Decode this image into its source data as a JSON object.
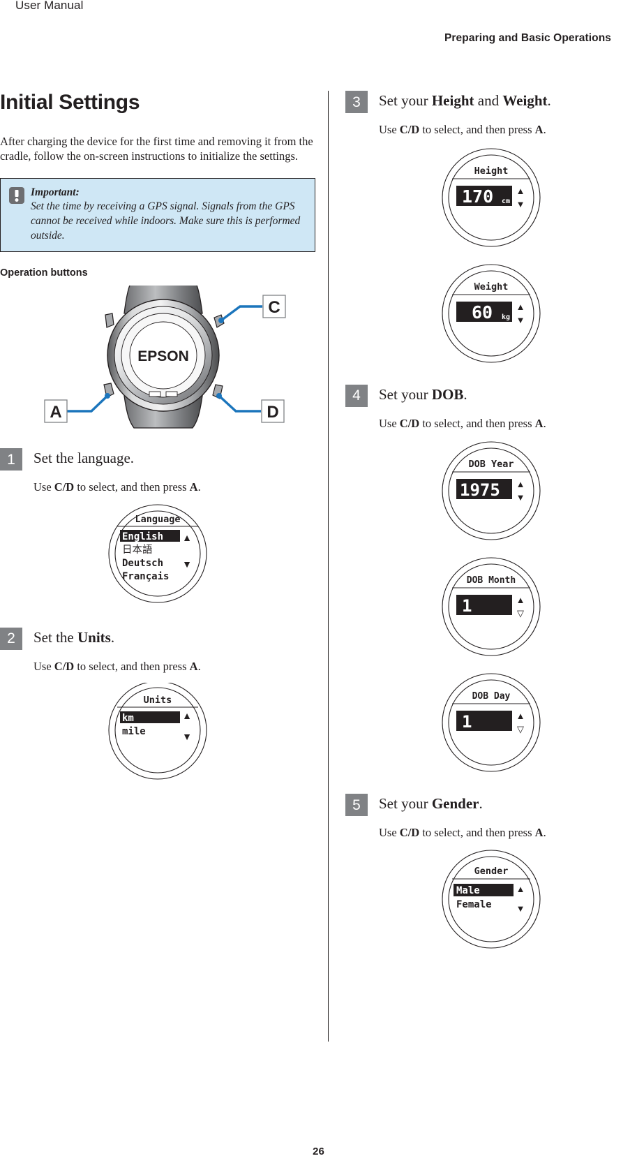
{
  "header": {
    "doc_title": "User Manual",
    "section_title": "Preparing and Basic Operations"
  },
  "footer": {
    "page_number": "26"
  },
  "left_column": {
    "title": "Initial Settings",
    "intro": "After charging the device for the first time and removing it from the cradle, follow the on-screen instructions to initialize the settings.",
    "important": {
      "label": "Important:",
      "text": "Set the time by receiving a GPS signal. Signals from the GPS cannot be received while indoors. Make sure this is performed outside.",
      "bg_color": "#cfe7f5",
      "icon_color": "#6d6e71"
    },
    "operation_buttons_heading": "Operation buttons",
    "device": {
      "brand": "EPSON",
      "callouts": [
        {
          "id": "A",
          "label": "A",
          "position": "bottom-left"
        },
        {
          "id": "C",
          "label": "C",
          "position": "top-right"
        },
        {
          "id": "D",
          "label": "D",
          "position": "bottom-right"
        }
      ],
      "callout_line_color": "#1b75bc"
    },
    "steps": [
      {
        "number": "1",
        "title_plain": "Set the language.",
        "instruction_prefix": "Use ",
        "instruction_keys": "C/D",
        "instruction_mid": " to select, and then press ",
        "instruction_key2": "A",
        "instruction_suffix": ".",
        "screen": {
          "title": "Language",
          "type": "list",
          "items": [
            "English",
            "日本語",
            "Deutsch",
            "Français"
          ],
          "selected_index": 0,
          "up_arrow": "▲",
          "down_arrow": "▼"
        }
      },
      {
        "number": "2",
        "title_prefix": "Set the ",
        "title_bold": "Units",
        "title_suffix": ".",
        "instruction_prefix": "Use ",
        "instruction_keys": "C/D",
        "instruction_mid": " to select, and then press ",
        "instruction_key2": "A",
        "instruction_suffix": ".",
        "screen": {
          "title": "Units",
          "type": "list",
          "items": [
            "km",
            "mile"
          ],
          "selected_index": 0,
          "up_arrow": "▲",
          "down_arrow": "▼"
        }
      }
    ]
  },
  "right_column": {
    "steps": [
      {
        "number": "3",
        "title_prefix": "Set your ",
        "title_bold": "Height",
        "title_mid": " and ",
        "title_bold2": "Weight",
        "title_suffix": ".",
        "instruction_prefix": "Use ",
        "instruction_keys": "C/D",
        "instruction_mid": " to select, and then press ",
        "instruction_key2": "A",
        "instruction_suffix": ".",
        "screens": [
          {
            "title": "Height",
            "type": "value",
            "value": "170",
            "unit": "cm",
            "up_arrow": "▲",
            "down_arrow": "▼"
          },
          {
            "title": "Weight",
            "type": "value",
            "value": "60",
            "unit": "kg",
            "up_arrow": "▲",
            "down_arrow": "▼"
          }
        ]
      },
      {
        "number": "4",
        "title_prefix": "Set your ",
        "title_bold": "DOB",
        "title_suffix": ".",
        "instruction_prefix": "Use ",
        "instruction_keys": "C/D",
        "instruction_mid": " to select, and then press ",
        "instruction_key2": "A",
        "instruction_suffix": ".",
        "screens": [
          {
            "title": "DOB Year",
            "type": "value",
            "value": "1975",
            "unit": "",
            "up_arrow": "▲",
            "down_arrow": "▼"
          },
          {
            "title": "DOB Month",
            "type": "value",
            "value": "1",
            "unit": "",
            "up_arrow": "▲",
            "down_arrow": "▽"
          },
          {
            "title": "DOB Day",
            "type": "value",
            "value": "1",
            "unit": "",
            "up_arrow": "▲",
            "down_arrow": "▽"
          }
        ]
      },
      {
        "number": "5",
        "title_prefix": "Set your ",
        "title_bold": "Gender",
        "title_suffix": ".",
        "instruction_prefix": "Use ",
        "instruction_keys": "C/D",
        "instruction_mid": " to select, and then press ",
        "instruction_key2": "A",
        "instruction_suffix": ".",
        "screens": [
          {
            "title": "Gender",
            "type": "list",
            "items": [
              "Male",
              "Female"
            ],
            "selected_index": 0,
            "up_arrow": "▲",
            "down_arrow": "▼"
          }
        ]
      }
    ]
  }
}
